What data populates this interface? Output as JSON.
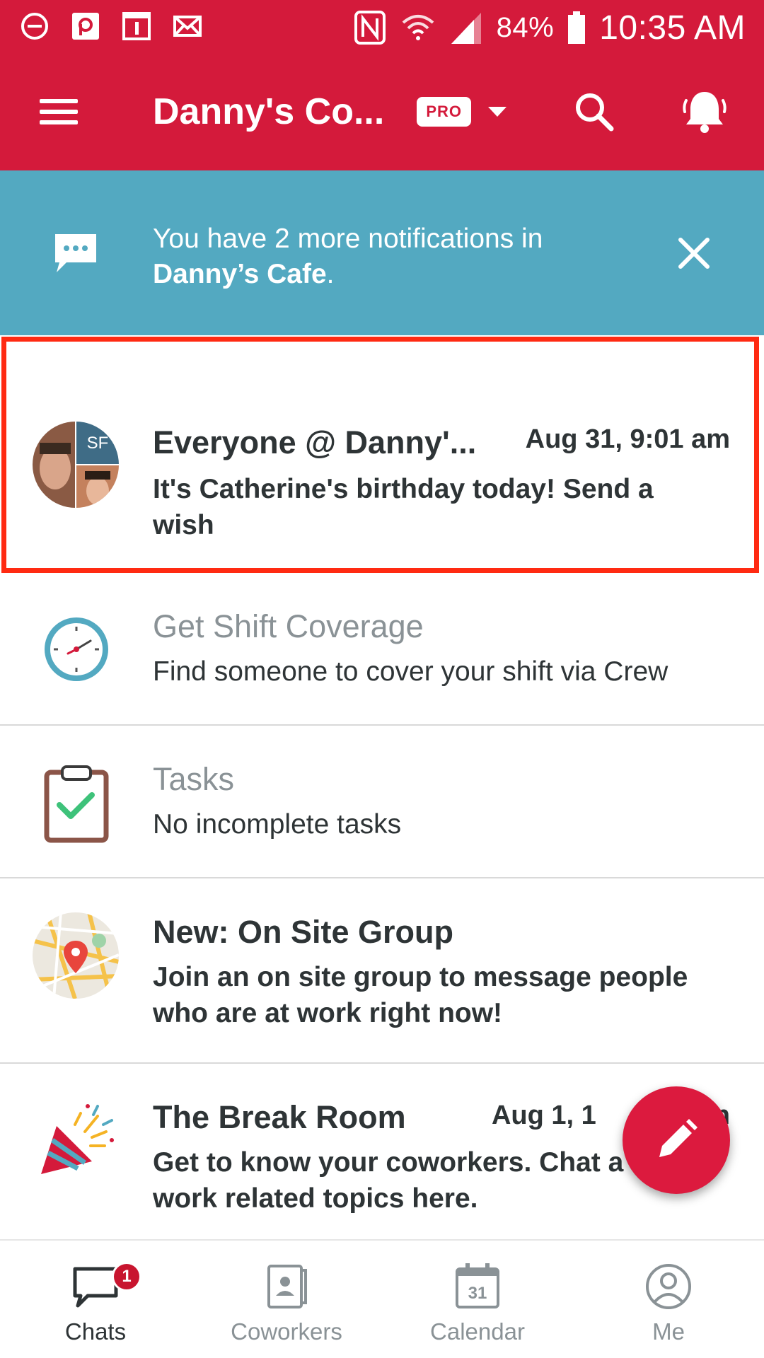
{
  "status_bar": {
    "battery": "84%",
    "time": "10:35 AM",
    "icons": [
      "do-not-disturb-icon",
      "app-icon",
      "calendar-icon",
      "mail-icon",
      "nfc-icon",
      "wifi-icon",
      "signal-icon",
      "battery-icon"
    ]
  },
  "app_bar": {
    "title": "Danny's Co...",
    "badge": "PRO"
  },
  "banner": {
    "text": "You have 2 more notifications in",
    "bold_text": "Danny’s Cafe",
    "suffix": "."
  },
  "rows": [
    {
      "title": "Everyone @ Danny'...",
      "time": "Aug 31, 9:01 am",
      "subtitle": "It's Catherine's birthday today! Send a wish",
      "avatar_initials": "SF"
    },
    {
      "title": "Get Shift Coverage",
      "subtitle": "Find someone to cover your shift via Crew"
    },
    {
      "title": "Tasks",
      "subtitle": "No incomplete tasks"
    },
    {
      "title": "New: On Site Group",
      "subtitle": "Join an on site group to message people who are at work right now!"
    },
    {
      "title": "The Break Room",
      "time": "Aug 1, 1",
      "time_suffix": "n",
      "subtitle": "Get to know your coworkers. Chat a non-work related topics here."
    }
  ],
  "bottom_nav": {
    "tabs": [
      {
        "label": "Chats",
        "badge": "1"
      },
      {
        "label": "Coworkers"
      },
      {
        "label": "Calendar",
        "calendar_day": "31"
      },
      {
        "label": "Me"
      }
    ]
  },
  "colors": {
    "brand_red": "#d41a3b",
    "banner_blue": "#53a9c1",
    "highlight": "#ff2a12"
  }
}
